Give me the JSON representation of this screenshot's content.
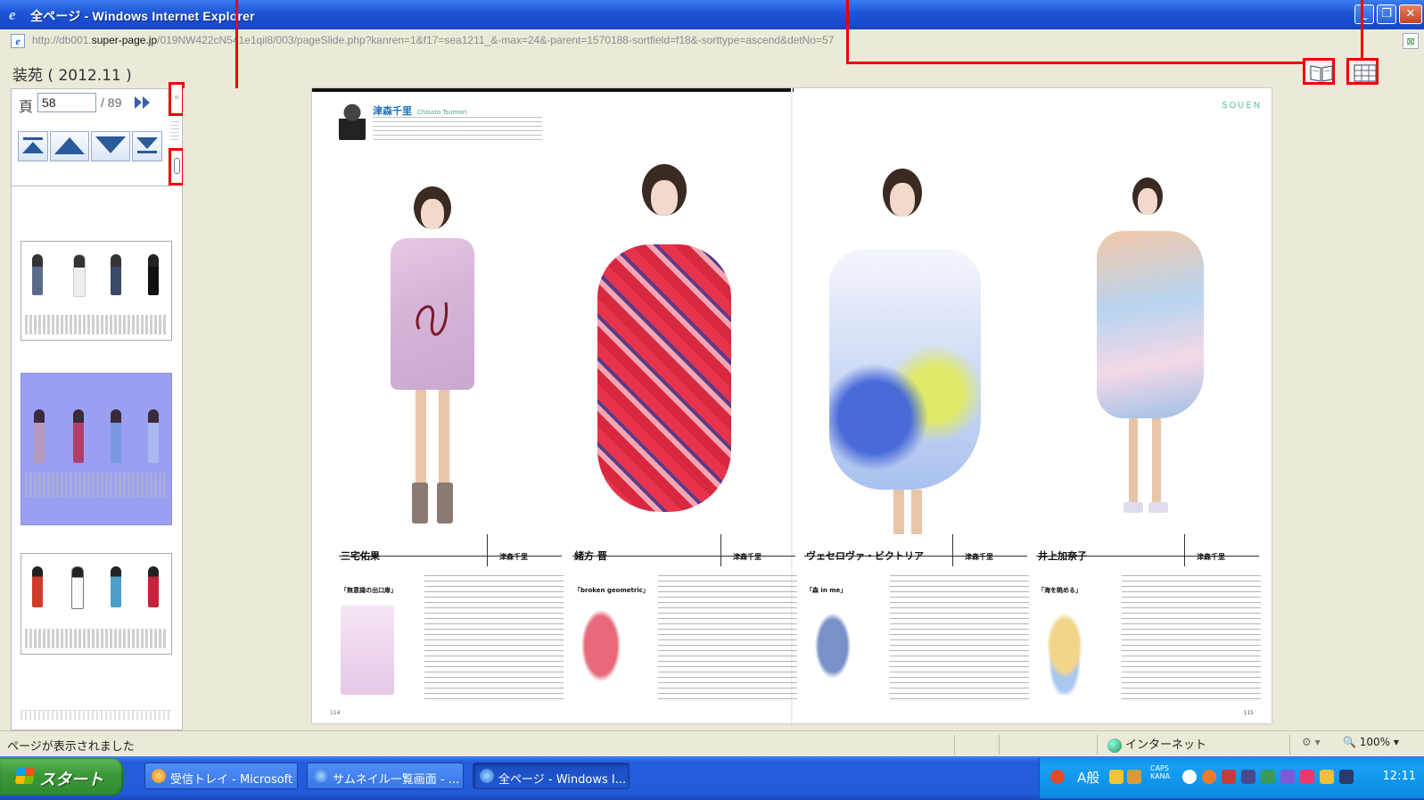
{
  "window": {
    "title": "全ページ - Windows Internet Explorer",
    "controls": {
      "minimize": "_",
      "restore": "❐",
      "close": "✕"
    }
  },
  "address": {
    "url_prefix": "http://db001.",
    "url_host": "super-page.jp",
    "url_rest": "/019NW422cN541e1qil8/003/pageSlide.php?kanren=1&f17=sea1211_&-max=24&-parent=1570188-sortfield=f18&-sorttype=ascend&detNo=57"
  },
  "viewer": {
    "doc_title": "装苑 ( 2012.11 )",
    "page_label": "頁",
    "page_value": "58",
    "page_total": "/ 89",
    "view_buttons": [
      "book-view",
      "grid-view"
    ]
  },
  "sidebar": {
    "collapse_glyph": "«",
    "nav_buttons": [
      "first-page",
      "previous-page",
      "next-page",
      "last-page"
    ],
    "thumbnails": [
      {
        "label": "thumbnail-page-56",
        "selected": false
      },
      {
        "label": "thumbnail-page-58",
        "selected": true
      },
      {
        "label": "thumbnail-page-60",
        "selected": false
      }
    ]
  },
  "spread": {
    "mentor_name": "津森千里",
    "mentor_name_en": "Chisato Tsumori",
    "section_tag": "ＳＯＵＥＮ",
    "left_page_no": "114",
    "right_page_no": "115",
    "captions": [
      {
        "name": "三宅佑果",
        "role": "津森千里",
        "work": "「無意識の出口扉」",
        "sketch_color": "#e6c6e8"
      },
      {
        "name": "緒方 晋",
        "role": "津森千里",
        "work": "「broken geometric」",
        "sketch_color": "#f3c2c2"
      },
      {
        "name": "ヴェセロヴァ・ビクトリア",
        "role": "津森千里",
        "work": "「森 in me」",
        "sketch_color": "#c9d6ea"
      },
      {
        "name": "井上加奈子",
        "role": "津森千里",
        "work": "「海を眺める」",
        "sketch_color": "#f2e2b0"
      }
    ]
  },
  "status": {
    "text": "ページが表示されました",
    "zone": "インターネット",
    "zoom": "100%"
  },
  "taskbar": {
    "start": "スタート",
    "tasks": [
      {
        "label": "受信トレイ - Microsoft ...",
        "active": false
      },
      {
        "label": "サムネイル一覧画面 - ...",
        "active": false
      },
      {
        "label": "全ページ - Windows I...",
        "active": true
      }
    ],
    "ime": "A般",
    "caps": "CAPS",
    "kana": "KANA",
    "clock": "12:11"
  },
  "colors": {
    "annotation": "#e00000",
    "selected_thumb": "#9a9ff2",
    "taskbar": "#245ee0"
  }
}
